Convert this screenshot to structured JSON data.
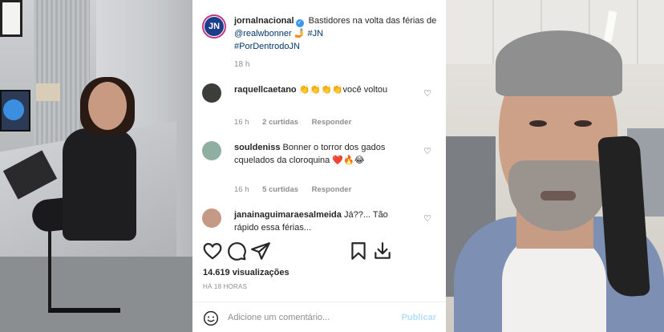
{
  "post": {
    "username": "jornalnacional",
    "avatar_text": "JN",
    "caption_text": "Bastidores na volta das férias de ",
    "mention": "@realwbonner",
    "caption_emoji": "🤳",
    "hashtag1": "#JN",
    "hashtag2": "#PorDentrodoJN",
    "caption_time": "18 h"
  },
  "comments": [
    {
      "username": "raquellcaetano",
      "text": "👏👏👏👏você voltou",
      "time": "16 h",
      "likes": "2 curtidas",
      "reply": "Responder",
      "avatar_color": "#3a3f3a"
    },
    {
      "username": "souldeniss",
      "text": "Bonner o torror dos gados cquelados da cloroquina ❤️🔥😂",
      "time": "16 h",
      "likes": "5 curtidas",
      "reply": "Responder",
      "avatar_color": "#8fb0a0"
    },
    {
      "username": "janainaguimaraesalmeida",
      "text": "Já??... Tão rápido essa férias...",
      "avatar_color": "#c49a86"
    }
  ],
  "stats": {
    "views": "14.619 visualizações",
    "posted": "HÁ 18 HORAS"
  },
  "comment_box": {
    "placeholder": "Adicione um comentário...",
    "publish_label": "Publicar"
  },
  "colors": {
    "accent_blue": "#3897f0",
    "link_blue": "#00376b",
    "muted": "#8e8e8e"
  }
}
